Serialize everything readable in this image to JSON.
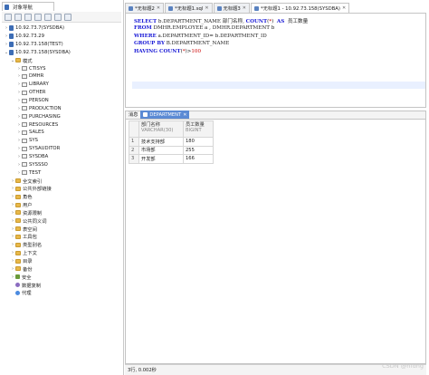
{
  "navigator": {
    "tab_label": "对象导航",
    "tree": [
      {
        "label": "10.92.73.7(SYSDBA)",
        "depth": 0,
        "twisty": "›",
        "icon": "db"
      },
      {
        "label": "10.92.73.29",
        "depth": 0,
        "twisty": "›",
        "icon": "db"
      },
      {
        "label": "10.92.73.158(TEST)",
        "depth": 0,
        "twisty": "›",
        "icon": "db"
      },
      {
        "label": "10.92.73.158(SYSDBA)",
        "depth": 0,
        "twisty": "⌄",
        "icon": "db"
      },
      {
        "label": "模式",
        "depth": 1,
        "twisty": "⌄",
        "icon": "folder"
      },
      {
        "label": "CTISYS",
        "depth": 2,
        "twisty": "›",
        "icon": "schema"
      },
      {
        "label": "DMHR",
        "depth": 2,
        "twisty": "›",
        "icon": "schema"
      },
      {
        "label": "LIBRARY",
        "depth": 2,
        "twisty": "›",
        "icon": "schema"
      },
      {
        "label": "OTHER",
        "depth": 2,
        "twisty": "›",
        "icon": "schema"
      },
      {
        "label": "PERSON",
        "depth": 2,
        "twisty": "›",
        "icon": "schema"
      },
      {
        "label": "PRODUCTION",
        "depth": 2,
        "twisty": "›",
        "icon": "schema"
      },
      {
        "label": "PURCHASING",
        "depth": 2,
        "twisty": "›",
        "icon": "schema"
      },
      {
        "label": "RESOURCES",
        "depth": 2,
        "twisty": "›",
        "icon": "schema"
      },
      {
        "label": "SALES",
        "depth": 2,
        "twisty": "›",
        "icon": "schema"
      },
      {
        "label": "SYS",
        "depth": 2,
        "twisty": "›",
        "icon": "schema"
      },
      {
        "label": "SYSAUDITOR",
        "depth": 2,
        "twisty": "›",
        "icon": "schema"
      },
      {
        "label": "SYSDBA",
        "depth": 2,
        "twisty": "›",
        "icon": "schema"
      },
      {
        "label": "SYSSSO",
        "depth": 2,
        "twisty": "›",
        "icon": "schema"
      },
      {
        "label": "TEST",
        "depth": 2,
        "twisty": "›",
        "icon": "schema"
      },
      {
        "label": "全文索引",
        "depth": 1,
        "twisty": "›",
        "icon": "folder"
      },
      {
        "label": "公共外部链接",
        "depth": 1,
        "twisty": "›",
        "icon": "folder"
      },
      {
        "label": "角色",
        "depth": 1,
        "twisty": "›",
        "icon": "folder"
      },
      {
        "label": "用户",
        "depth": 1,
        "twisty": "›",
        "icon": "folder"
      },
      {
        "label": "资源限制",
        "depth": 1,
        "twisty": "›",
        "icon": "folder"
      },
      {
        "label": "公共同义词",
        "depth": 1,
        "twisty": "›",
        "icon": "folder"
      },
      {
        "label": "表空间",
        "depth": 1,
        "twisty": "›",
        "icon": "folder"
      },
      {
        "label": "工具包",
        "depth": 1,
        "twisty": "›",
        "icon": "folder"
      },
      {
        "label": "类型别名",
        "depth": 1,
        "twisty": "›",
        "icon": "folder"
      },
      {
        "label": "上下文",
        "depth": 1,
        "twisty": "›",
        "icon": "folder"
      },
      {
        "label": "目录",
        "depth": 1,
        "twisty": "›",
        "icon": "folder"
      },
      {
        "label": "备份",
        "depth": 1,
        "twisty": "›",
        "icon": "folder"
      },
      {
        "label": "安全",
        "depth": 1,
        "twisty": "›",
        "icon": "lock"
      },
      {
        "label": "数据复制",
        "depth": 1,
        "twisty": "",
        "icon": "gear"
      },
      {
        "label": "代理",
        "depth": 1,
        "twisty": "",
        "icon": "user"
      }
    ]
  },
  "editor_tabs": [
    {
      "label": "*无标题2",
      "active": false
    },
    {
      "label": "*无标题1.sql",
      "active": false
    },
    {
      "label": "无标题3",
      "active": false
    },
    {
      "label": "*无标题1 - 10.92.73.158(SYSDBA)",
      "active": true
    }
  ],
  "sql": {
    "line1_kw1": "SELECT",
    "line1_a": " b.DEPARTMENT_NAME 部门名称, ",
    "line1_kw2": "COUNT",
    "line1_b": "(",
    "line1_c": "*",
    "line1_d": ")  ",
    "line1_kw3": "AS",
    "line1_e": "  员工数量",
    "line2_kw1": "FROM",
    "line2_a": " DMHR.EMPLOYEE a , DMHR.DEPARTMENT b",
    "line3_kw1": "WHERE",
    "line3_a": " a.DEPARTMENT_ID= b.DEPARTMENT_ID",
    "line4_kw1": "GROUP BY",
    "line4_a": " B.DEPARTMENT_NAME",
    "line5_kw1": "HAVING",
    "line5_kw2": " COUNT",
    "line5_a": "(",
    "line5_b": "*",
    "line5_c": ")>",
    "line5_d": "100"
  },
  "results": {
    "tabs": [
      {
        "label": "消息",
        "active": false
      },
      {
        "label": "DEPARTMENT",
        "active": true
      }
    ],
    "columns": [
      {
        "name": "部门名称",
        "type": "VARCHAR(30)"
      },
      {
        "name": "员工数量",
        "type": "BIGINT"
      }
    ],
    "rows": [
      {
        "n": "1",
        "c1": "技术支持部",
        "c2": "180"
      },
      {
        "n": "2",
        "c1": "市场部",
        "c2": "255"
      },
      {
        "n": "3",
        "c1": "开发部",
        "c2": "166"
      }
    ]
  },
  "status": {
    "text": "3行, 0.002秒"
  },
  "watermark": "CSDN @hfdhg"
}
